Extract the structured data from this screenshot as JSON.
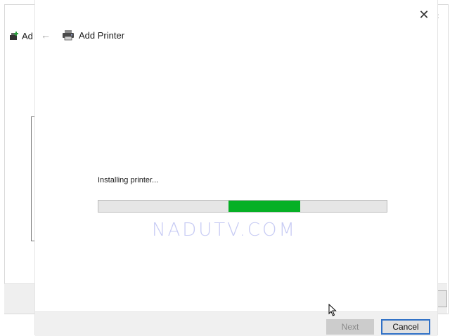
{
  "background_window": {
    "title": "Ad",
    "chevron": "‹"
  },
  "dialog": {
    "close_icon": "✕",
    "back_icon": "←",
    "title": "Add Printer",
    "status_text": "Installing printer...",
    "progress_fraction_start": 0.45,
    "progress_fraction_end": 0.7,
    "watermark": "NADUTV.COM",
    "buttons": {
      "next": "Next",
      "cancel": "Cancel"
    },
    "colors": {
      "progress_fill": "#06b025",
      "focus_border": "#2f70c6"
    }
  }
}
